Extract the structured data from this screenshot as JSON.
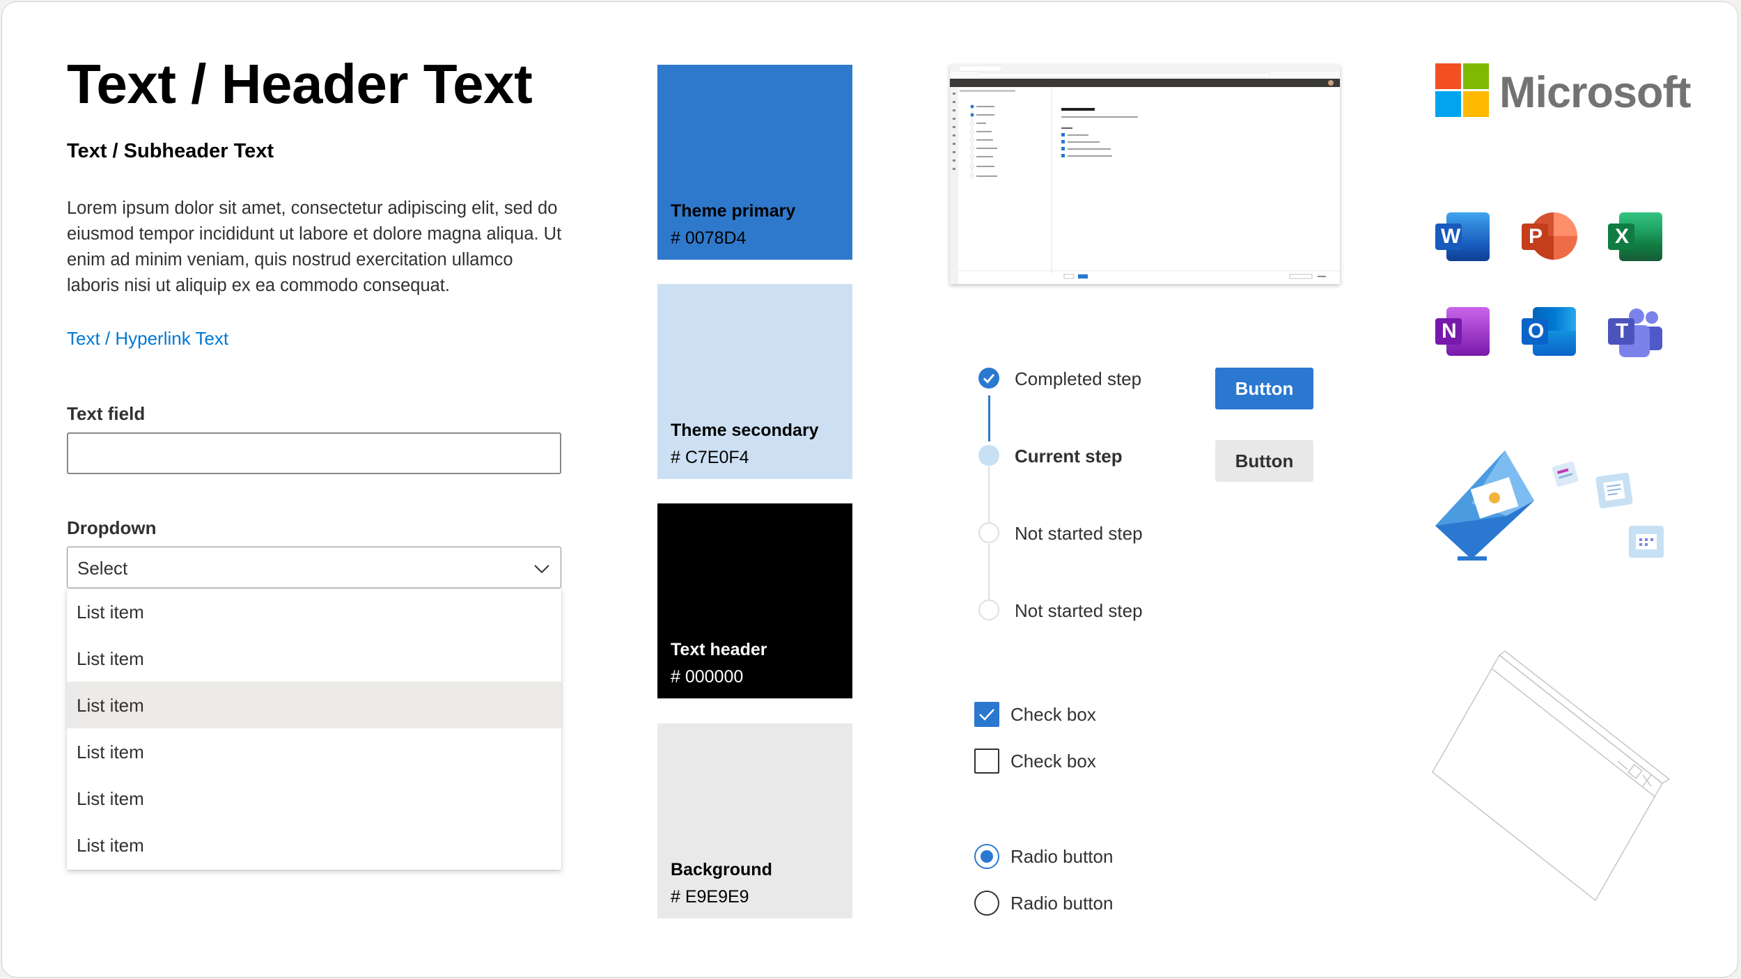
{
  "typography": {
    "header": "Text / Header Text",
    "subheader": "Text / Subheader Text",
    "body": "Lorem ipsum dolor sit amet, consectetur adipiscing elit, sed do eiusmod tempor incididunt ut labore et dolore magna aliqua. Ut enim ad minim veniam, quis nostrud exercitation ullamco laboris nisi ut aliquip ex ea commodo consequat.",
    "hyperlink": "Text / Hyperlink Text"
  },
  "text_field": {
    "label": "Text field",
    "value": ""
  },
  "dropdown": {
    "label": "Dropdown",
    "value": "Select",
    "items": [
      "List item",
      "List item",
      "List item",
      "List item",
      "List item",
      "List item"
    ],
    "hovered_index": 2
  },
  "swatches": [
    {
      "name": "Theme primary",
      "hex": "# 0078D4",
      "color": "#2f79cc",
      "text_color": "#000000"
    },
    {
      "name": "Theme secondary",
      "hex": "# C7E0F4",
      "color": "#cde0f3",
      "text_color": "#000000"
    },
    {
      "name": "Text header",
      "hex": "# 000000",
      "color": "#000000",
      "text_color": "#ffffff"
    },
    {
      "name": "Background",
      "hex": "# E9E9E9",
      "color": "#e9e9e9",
      "text_color": "#000000"
    }
  ],
  "steps": [
    {
      "label": "Completed step",
      "state": "completed"
    },
    {
      "label": "Current step",
      "state": "current"
    },
    {
      "label": "Not started step",
      "state": "not-started"
    },
    {
      "label": "Not started step",
      "state": "not-started"
    }
  ],
  "buttons": {
    "primary": "Button",
    "secondary": "Button"
  },
  "checkboxes": [
    {
      "label": "Check box",
      "checked": true
    },
    {
      "label": "Check box",
      "checked": false
    }
  ],
  "radios": [
    {
      "label": "Radio button",
      "selected": true
    },
    {
      "label": "Radio button",
      "selected": false
    }
  ],
  "brand": {
    "name": "Microsoft",
    "logo_colors": [
      "#f25022",
      "#7fba00",
      "#00a4ef",
      "#ffb900"
    ]
  },
  "apps": [
    {
      "icon": "word-icon",
      "letter": "W",
      "color": "#185abd"
    },
    {
      "icon": "powerpoint-icon",
      "letter": "P",
      "color": "#c43e1c"
    },
    {
      "icon": "excel-icon",
      "letter": "X",
      "color": "#107c41"
    },
    {
      "icon": "onenote-icon",
      "letter": "N",
      "color": "#7719aa"
    },
    {
      "icon": "outlook-icon",
      "letter": "O",
      "color": "#0a64c8"
    },
    {
      "icon": "teams-icon",
      "letter": "T",
      "color": "#4b53bc"
    }
  ],
  "accent_color": "#2b78d0"
}
